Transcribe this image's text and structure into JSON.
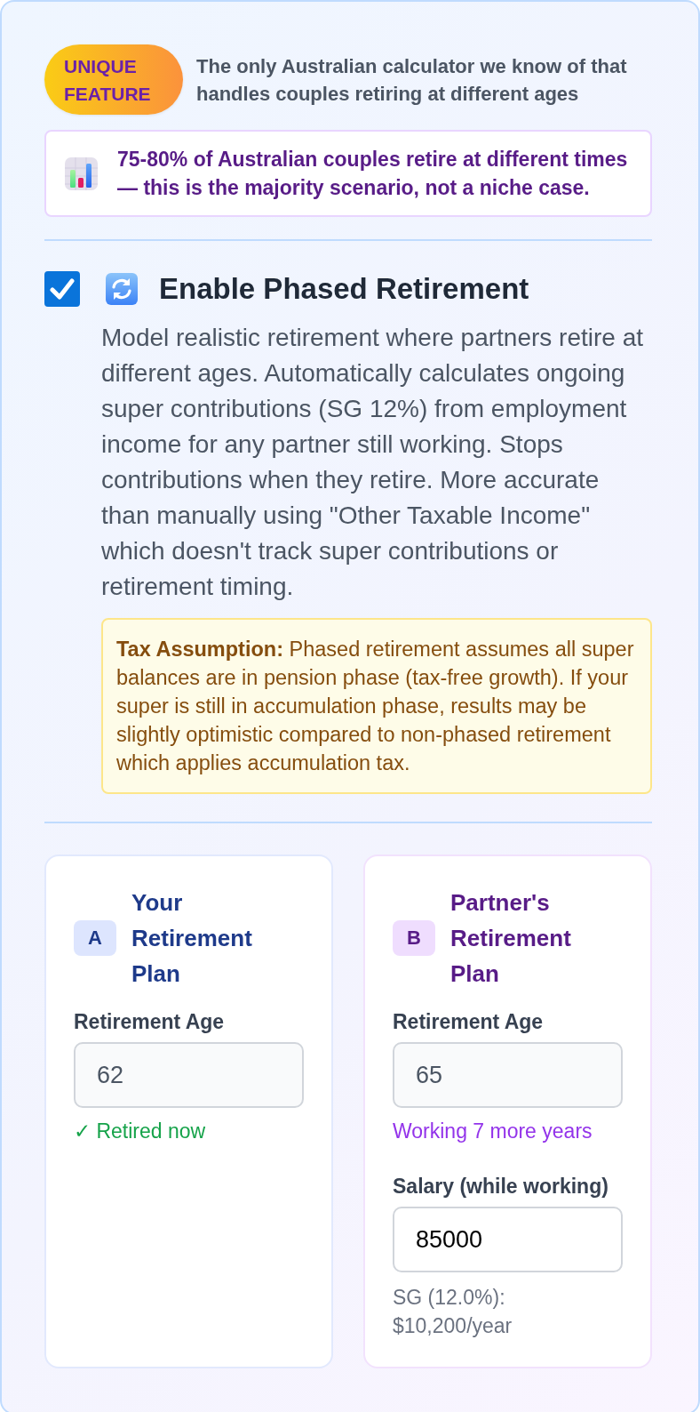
{
  "feature_banner": {
    "badge": "UNIQUE FEATURE",
    "text": "The only Australian calculator we know of that handles couples retiring at different ages"
  },
  "stat_callout": {
    "text": "75-80% of Australian couples retire at different times — this is the majority scenario, not a niche case."
  },
  "phased_retirement": {
    "checked": true,
    "title": "Enable Phased Retirement",
    "description": "Model realistic retirement where partners retire at different ages. Automatically calculates ongoing super contributions (SG 12%) from employment income for any partner still working. Stops contributions when they retire. More accurate than manually using \"Other Taxable Income\" which doesn't track super contributions or retirement timing.",
    "note": "**Tax Assumption:** Phased retirement assumes all super balances are in pension phase (tax-free growth). If your super is still in accumulation phase, results may be slightly optimistic compared to non-phased retirement which applies accumulation tax."
  },
  "partners": [
    {
      "badge": "A",
      "title": "Your Retirement Plan",
      "color": "#1e3a8a",
      "retirement_age": {
        "label": "Retirement Age",
        "value": "62",
        "disabled": true
      },
      "status": {
        "kind": "retired",
        "text": "✓ Retired now"
      }
    },
    {
      "badge": "B",
      "title": "Partner's Retirement Plan",
      "color": "#581c87",
      "retirement_age": {
        "label": "Retirement Age",
        "value": "65",
        "disabled": true
      },
      "status": {
        "kind": "working",
        "text": "Working 7 more years"
      },
      "salary": {
        "label": "Salary (while working)",
        "value": "85000",
        "disabled": false
      },
      "sg_note": "SG (12.0%): $10,200/year"
    }
  ]
}
